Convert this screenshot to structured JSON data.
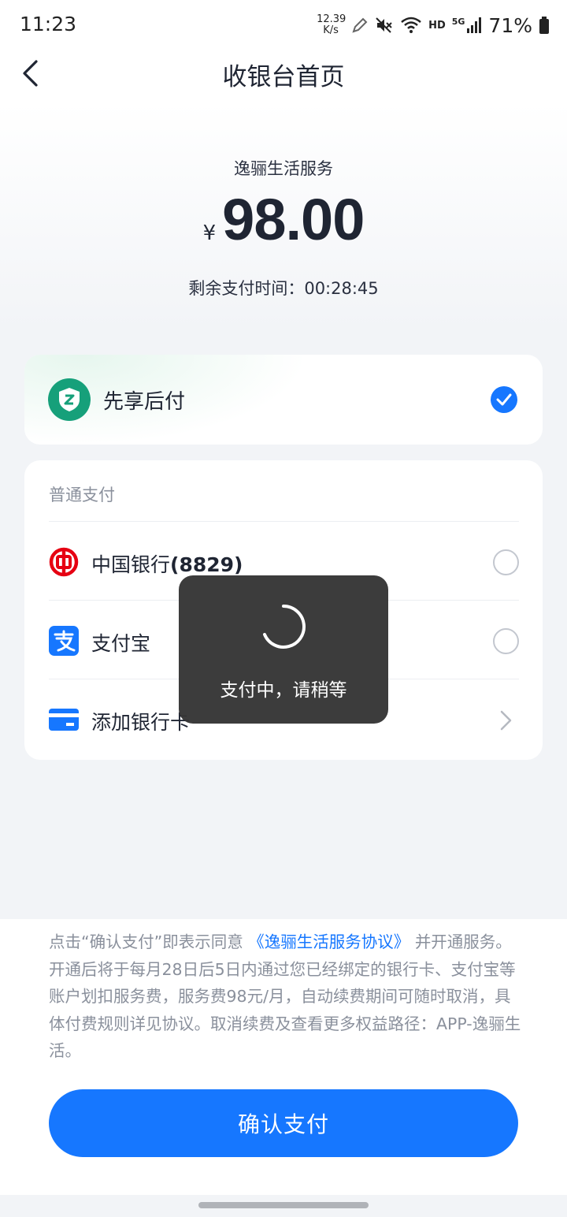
{
  "status_bar": {
    "time": "11:23",
    "net_speed_value": "12.39",
    "net_speed_unit": "K/s",
    "hd": "HD",
    "network": "5G",
    "battery": "71%"
  },
  "nav": {
    "title": "收银台首页",
    "back_icon": "chevron-left-icon"
  },
  "order": {
    "merchant": "逸骊生活服务",
    "currency_symbol": "¥",
    "amount": "98.00",
    "countdown": "剩余支付时间：00:28:45"
  },
  "bnpl": {
    "label": "先享后付",
    "selected": true,
    "icon": "shield-s-icon"
  },
  "payment": {
    "section_title": "普通支付",
    "methods": [
      {
        "label": "中国银行",
        "suffix": "(8829)",
        "icon": "bank-of-china-icon",
        "selected": false
      },
      {
        "label": "支付宝",
        "icon": "alipay-icon",
        "selected": false
      },
      {
        "label": "添加银行卡",
        "icon": "card-icon"
      }
    ]
  },
  "loading": {
    "text": "支付中，请稍等"
  },
  "agreement": {
    "prefix": "点击“确认支付”即表示同意",
    "link": "《逸骊生活服务协议》",
    "suffix": "并开通服务。 开通后将于每月28日后5日内通过您已经绑定的银行卡、支付宝等账户划扣服务费，服务费98元/月，自动续费期间可随时取消，具体付费规则详见协议。取消续费及查看更多权益路径：APP-逸骊生活。"
  },
  "confirm_button": {
    "label": "确认支付"
  },
  "colors": {
    "primary": "#1677ff",
    "bnpl_green": "#16a07a",
    "boc_red": "#e60012"
  }
}
